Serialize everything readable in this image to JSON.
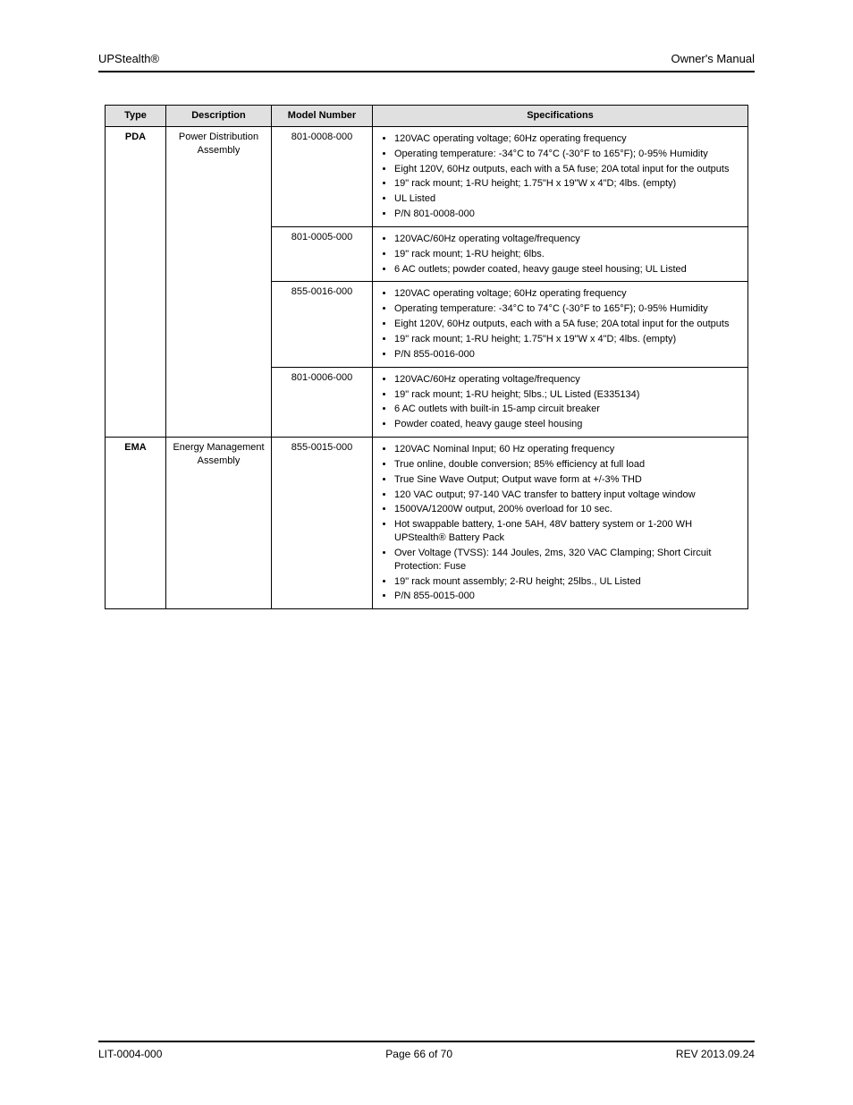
{
  "header": {
    "left": "UPStealth®",
    "right": "Owner's Manual"
  },
  "columns": {
    "c1": "Type",
    "c2": "Description",
    "c3": "Model Number",
    "c4": "Specifications"
  },
  "rows": [
    {
      "type": "PDA",
      "desc": "Power Distribution Assembly",
      "cells": [
        {
          "model": "801-0008-000",
          "specs": [
            "120VAC operating voltage; 60Hz operating frequency",
            "Operating temperature: -34°C to 74°C (-30°F to 165°F); 0-95% Humidity",
            "Eight 120V, 60Hz outputs, each with a 5A fuse; 20A total input for the outputs",
            "19\" rack mount; 1-RU height; 1.75\"H x 19\"W x 4\"D; 4lbs. (empty)",
            "UL Listed",
            "P/N 801-0008-000"
          ]
        },
        {
          "model": "801-0005-000",
          "specs": [
            "120VAC/60Hz operating voltage/frequency",
            "19\" rack mount; 1-RU height; 6lbs.",
            "6 AC outlets; powder coated, heavy gauge steel housing; UL Listed"
          ]
        },
        {
          "model": "855-0016-000",
          "specs": [
            "120VAC operating voltage; 60Hz operating frequency",
            "Operating temperature: -34°C to 74°C (-30°F to 165°F); 0-95% Humidity",
            "Eight 120V, 60Hz outputs, each with a 5A fuse; 20A total input for the outputs",
            "19\" rack mount; 1-RU height; 1.75\"H x 19\"W x 4\"D; 4lbs. (empty)",
            "P/N 855-0016-000"
          ]
        },
        {
          "model": "801-0006-000",
          "specs": [
            "120VAC/60Hz operating voltage/frequency",
            "19\" rack mount; 1-RU height; 5lbs.; UL Listed (E335134)",
            "6 AC outlets with built-in 15-amp circuit breaker",
            "Powder coated, heavy gauge steel housing"
          ]
        }
      ]
    },
    {
      "type": "EMA",
      "desc": "Energy Management Assembly",
      "cells": [
        {
          "model": "855-0015-000",
          "specs": [
            "120VAC Nominal Input; 60 Hz operating frequency",
            "True online, double conversion; 85% efficiency at full load",
            "True Sine Wave Output; Output wave form at +/-3% THD",
            "120 VAC output; 97-140 VAC transfer to battery input voltage window",
            "1500VA/1200W output, 200% overload for 10 sec.",
            "Hot swappable battery, 1-one 5AH, 48V battery system or 1-200 WH UPStealth® Battery Pack",
            "Over Voltage (TVSS): 144 Joules, 2ms, 320 VAC Clamping; Short Circuit Protection: Fuse",
            "19\" rack mount assembly; 2-RU height; 25lbs., UL Listed",
            "P/N 855-0015-000"
          ]
        }
      ]
    }
  ],
  "footer": {
    "left": "LIT-0004-000",
    "center": "Page 66 of 70",
    "right": "REV 2013.09.24"
  }
}
